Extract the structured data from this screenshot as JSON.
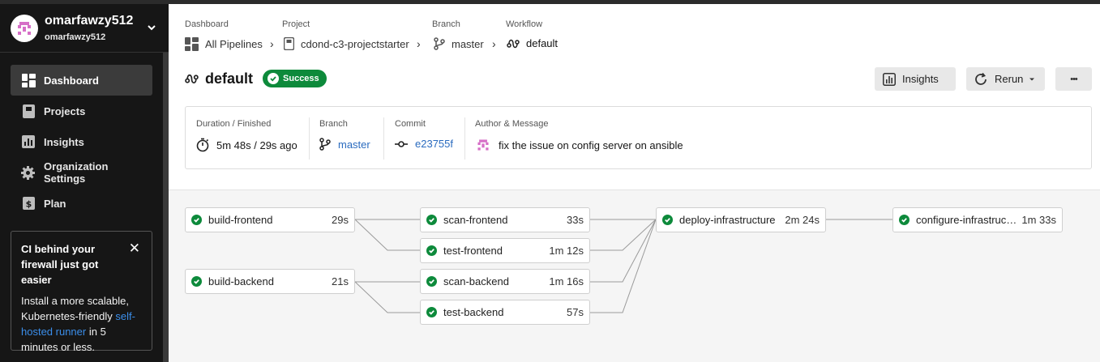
{
  "org": {
    "name": "omarfawzy512",
    "sub": "omarfawzy512"
  },
  "nav": {
    "dashboard": "Dashboard",
    "projects": "Projects",
    "insights": "Insights",
    "org_settings": "Organization Settings",
    "plan": "Plan"
  },
  "promo": {
    "title": "CI behind your firewall just got easier",
    "text_before": "Install a more scalable, Kubernetes-friendly ",
    "link": "self-hosted runner",
    "text_after": " in 5 minutes or less.",
    "close": "✕"
  },
  "breadcrumb": {
    "dashboard_label": "Dashboard",
    "dashboard_val": "All Pipelines",
    "project_label": "Project",
    "project_val": "cdond-c3-projectstarter",
    "branch_label": "Branch",
    "branch_val": "master",
    "workflow_label": "Workflow",
    "workflow_val": "default",
    "sep": "›"
  },
  "workflow": {
    "title": "default",
    "status": "Success"
  },
  "buttons": {
    "insights": "Insights",
    "rerun": "Rerun",
    "more": "•••"
  },
  "meta": {
    "duration_label": "Duration / Finished",
    "duration_val": "5m 48s / 29s ago",
    "branch_label": "Branch",
    "branch_val": "master",
    "commit_label": "Commit",
    "commit_val": "e23755f",
    "author_label": "Author & Message",
    "message": "fix the issue on config server on ansible"
  },
  "jobs": {
    "build_frontend": {
      "name": "build-frontend",
      "dur": "29s"
    },
    "build_backend": {
      "name": "build-backend",
      "dur": "21s"
    },
    "scan_frontend": {
      "name": "scan-frontend",
      "dur": "33s"
    },
    "test_frontend": {
      "name": "test-frontend",
      "dur": "1m 12s"
    },
    "scan_backend": {
      "name": "scan-backend",
      "dur": "1m 16s"
    },
    "test_backend": {
      "name": "test-backend",
      "dur": "57s"
    },
    "deploy_infrastructure": {
      "name": "deploy-infrastructure",
      "dur": "2m 24s"
    },
    "configure_infrastructure": {
      "name": "configure-infrastructure",
      "dur": "1m 33s"
    }
  },
  "colors": {
    "success": "#0d8a3b",
    "link": "#2a6bbf",
    "sidebar": "#161616"
  }
}
